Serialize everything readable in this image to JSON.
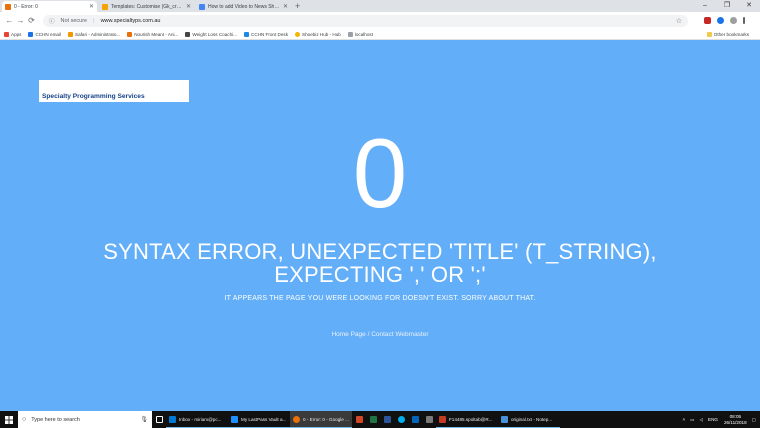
{
  "browser": {
    "tabs": [
      {
        "title": "0 - Error: 0",
        "favicon_color": "#e8710a",
        "active": true
      },
      {
        "title": "Templates: Customise (Gk_creati...",
        "favicon_color": "#f4a300",
        "active": false
      },
      {
        "title": "How to add Video to News Show...",
        "favicon_color": "#4285f4",
        "active": false
      }
    ],
    "new_tab": "+",
    "window_controls": [
      "–",
      "❐",
      "✕"
    ],
    "nav": {
      "back": "←",
      "forward": "→",
      "reload": "⟳"
    },
    "security_label": "Not secure",
    "separator": "|",
    "url": "www.specialtyps.com.au",
    "bookmark_star": "☆"
  },
  "bookmarks": [
    {
      "label": "Apps",
      "color": "#ea4335"
    },
    {
      "label": "CCHN email",
      "color": "#1a73e8"
    },
    {
      "label": "Safari - Administrato...",
      "color": "#f29900"
    },
    {
      "label": "Nourish Meant - Ani...",
      "color": "#e8710a"
    },
    {
      "label": "Weight Loss Coachi...",
      "color": "#444444"
    },
    {
      "label": "CCHN Front Desk",
      "color": "#1e88e5"
    },
    {
      "label": "Shoebiz Hub - Hub",
      "color": "#f4b400"
    },
    {
      "label": "localhost",
      "color": "#9aa0a6"
    }
  ],
  "other_bookmarks": "Other bookmarks",
  "page": {
    "logo_text": "Specialty Programming Services",
    "error_code": "0",
    "error_message": "SYNTAX ERROR, UNEXPECTED 'TITLE' (T_STRING), EXPECTING ',' OR ';'",
    "sub_message": "IT APPEARS THE PAGE YOU WERE LOOKING FOR DOESN'T EXIST. SORRY ABOUT THAT.",
    "home_link": "Home Page",
    "link_separator": " / ",
    "contact_link": "Contact Webmaster",
    "background_color": "#63aef8"
  },
  "taskbar": {
    "search_placeholder": "Type here to search",
    "items": [
      {
        "label": "Inbox - miriam@pc...",
        "color": "#0078d4",
        "active": false
      },
      {
        "label": "My LastPass Vault a...",
        "color": "#1e90ff",
        "active": false
      },
      {
        "label": "0 - Error: 0 - Google ...",
        "color": "#e8710a",
        "active": true
      },
      {
        "label": "F14485.spoltab@R...",
        "color": "#c23b22",
        "active": false
      },
      {
        "label": "original.txt - Notep...",
        "color": "#4a90d9",
        "active": false
      }
    ],
    "language": "ENG",
    "time": "08:05",
    "date": "26/11/2018"
  }
}
